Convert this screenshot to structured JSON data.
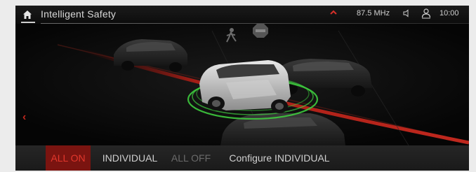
{
  "header": {
    "title": "Intelligent Safety",
    "radio": "87.5 MHz",
    "clock": "10:00",
    "icons": [
      "home-icon",
      "chevron-up-icon",
      "volume-icon",
      "person-icon"
    ]
  },
  "scene": {
    "icons": [
      "back-arrow-icon",
      "pedestrian-icon",
      "stop-sign-icon"
    ],
    "back_arrow": "‹",
    "accent_color": "#c0281e",
    "ring_color": "#3ecb3e"
  },
  "bottom": {
    "options": [
      {
        "label": "ALL ON",
        "state": "active"
      },
      {
        "label": "INDIVIDUAL",
        "state": "normal"
      },
      {
        "label": "ALL OFF",
        "state": "disabled"
      },
      {
        "label": "Configure INDIVIDUAL",
        "state": "normal"
      }
    ]
  }
}
